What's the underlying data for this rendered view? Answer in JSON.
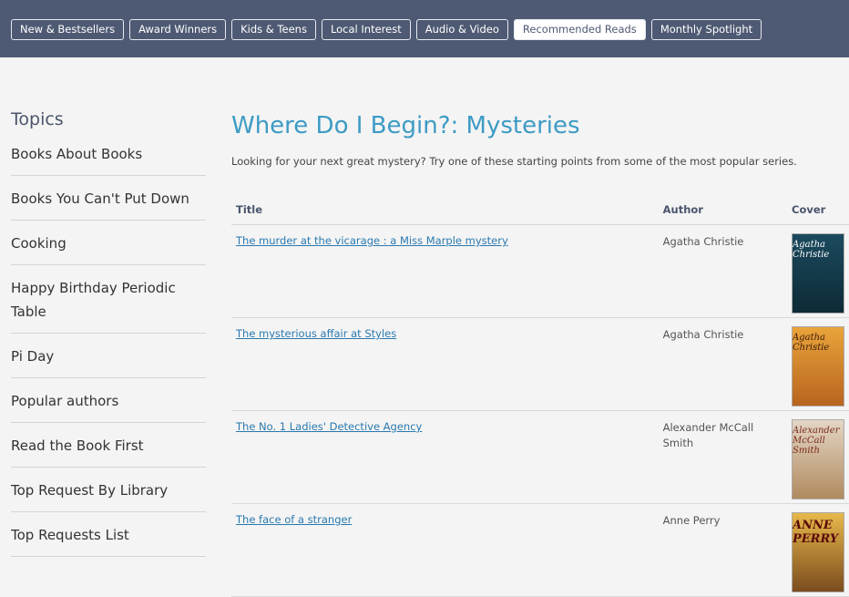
{
  "nav": {
    "tabs": [
      {
        "label": "New & Bestsellers"
      },
      {
        "label": "Award Winners"
      },
      {
        "label": "Kids & Teens"
      },
      {
        "label": "Local Interest"
      },
      {
        "label": "Audio & Video"
      },
      {
        "label": "Recommended Reads",
        "active": true
      },
      {
        "label": "Monthly Spotlight"
      }
    ]
  },
  "sidebar": {
    "title": "Topics",
    "items": [
      {
        "label": "Books About Books"
      },
      {
        "label": "Books You Can't Put Down"
      },
      {
        "label": "Cooking"
      },
      {
        "label": "Happy Birthday Periodic Table"
      },
      {
        "label": "Pi Day"
      },
      {
        "label": "Popular authors"
      },
      {
        "label": "Read the Book First"
      },
      {
        "label": "Top Request By Library"
      },
      {
        "label": "Top Requests List"
      }
    ]
  },
  "main": {
    "title": "Where Do I Begin?: Mysteries",
    "intro": "Looking for your next great mystery?  Try one of these starting points from some of the most popular series."
  },
  "table": {
    "headers": {
      "title": "Title",
      "author": "Author",
      "cover": "Cover"
    },
    "rows": [
      {
        "title": "The murder at the vicarage : a Miss Marple mystery",
        "author": "Agatha Christie",
        "cover_text": "Agatha Christie"
      },
      {
        "title": "The mysterious affair at Styles",
        "author": "Agatha Christie",
        "cover_text": "Agatha Christie"
      },
      {
        "title": "The No. 1 Ladies' Detective Agency",
        "author": "Alexander McCall Smith",
        "cover_text": "Alexander McCall Smith"
      },
      {
        "title": "The face of a stranger",
        "author": "Anne Perry",
        "cover_text": "ANNE PERRY"
      }
    ]
  }
}
